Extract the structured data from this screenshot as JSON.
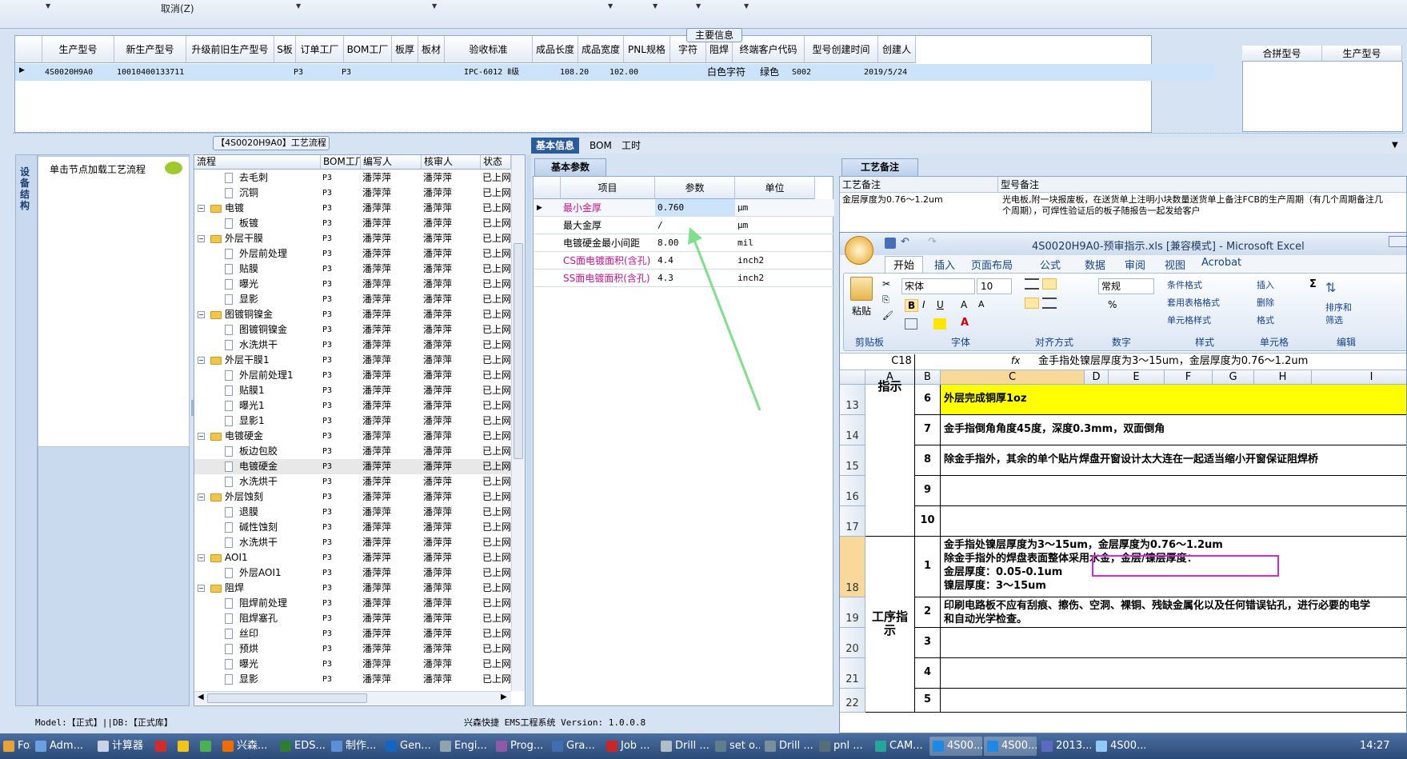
{
  "toolbar": {
    "cancel_label": "取消(Z)"
  },
  "main_info": {
    "title": "主要信息",
    "columns": [
      "生产型号",
      "新生产型号",
      "升级前旧生产型号",
      "S板",
      "订单工厂",
      "BOM工厂",
      "板厚",
      "板材",
      "验收标准",
      "成品长度",
      "成品宽度",
      "PNL规格",
      "字符",
      "阻焊",
      "终端客户代码",
      "型号创建时间",
      "创建人"
    ],
    "row": {
      "prod_model": "4S0020H9A0",
      "new_prod_model": "10010400133711",
      "order_factory": "P3",
      "bom_factory": "P3",
      "accept_std": "IPC-6012 Ⅱ级",
      "length": "108.20",
      "width": "102.00",
      "char": "白色字符",
      "solder": "绿色",
      "customer_code": "S002",
      "created": "2019/5/24"
    },
    "merge_columns": [
      "合拼型号",
      "生产型号"
    ]
  },
  "left_pane": {
    "vertical_tab": "设备结构",
    "click_node_label": "单击节点加载工艺流程"
  },
  "process": {
    "title": "【4S0020H9A0】工艺流程",
    "columns": [
      "流程",
      "BOM工厂",
      "编写人",
      "核审人",
      "状态"
    ],
    "rows": [
      {
        "name": "去毛刺",
        "type": "file",
        "level": 1,
        "factory": "P3",
        "writer": "潘萍萍",
        "reviewer": "潘萍萍",
        "status": "已上网"
      },
      {
        "name": "沉铜",
        "type": "file",
        "level": 1,
        "factory": "P3",
        "writer": "潘萍萍",
        "reviewer": "潘萍萍",
        "status": "已上网"
      },
      {
        "name": "电镀",
        "type": "folder",
        "level": 0,
        "factory": "P3",
        "writer": "潘萍萍",
        "reviewer": "潘萍萍",
        "status": "已上网"
      },
      {
        "name": "板镀",
        "type": "file",
        "level": 1,
        "factory": "P3",
        "writer": "潘萍萍",
        "reviewer": "潘萍萍",
        "status": "已上网"
      },
      {
        "name": "外层干膜",
        "type": "folder",
        "level": 0,
        "factory": "P3",
        "writer": "潘萍萍",
        "reviewer": "潘萍萍",
        "status": "已上网"
      },
      {
        "name": "外层前处理",
        "type": "file",
        "level": 1,
        "factory": "P3",
        "writer": "潘萍萍",
        "reviewer": "潘萍萍",
        "status": "已上网"
      },
      {
        "name": "贴膜",
        "type": "file",
        "level": 1,
        "factory": "P3",
        "writer": "潘萍萍",
        "reviewer": "潘萍萍",
        "status": "已上网"
      },
      {
        "name": "曝光",
        "type": "file",
        "level": 1,
        "factory": "P3",
        "writer": "潘萍萍",
        "reviewer": "潘萍萍",
        "status": "已上网"
      },
      {
        "name": "显影",
        "type": "file",
        "level": 1,
        "factory": "P3",
        "writer": "潘萍萍",
        "reviewer": "潘萍萍",
        "status": "已上网"
      },
      {
        "name": "图镀铜镍金",
        "type": "folder",
        "level": 0,
        "factory": "P3",
        "writer": "潘萍萍",
        "reviewer": "潘萍萍",
        "status": "已上网"
      },
      {
        "name": "图镀铜镍金",
        "type": "file",
        "level": 1,
        "factory": "P3",
        "writer": "潘萍萍",
        "reviewer": "潘萍萍",
        "status": "已上网"
      },
      {
        "name": "水洗烘干",
        "type": "file",
        "level": 1,
        "factory": "P3",
        "writer": "潘萍萍",
        "reviewer": "潘萍萍",
        "status": "已上网"
      },
      {
        "name": "外层干膜1",
        "type": "folder",
        "level": 0,
        "factory": "P3",
        "writer": "潘萍萍",
        "reviewer": "潘萍萍",
        "status": "已上网"
      },
      {
        "name": "外层前处理1",
        "type": "file",
        "level": 1,
        "factory": "P3",
        "writer": "潘萍萍",
        "reviewer": "潘萍萍",
        "status": "已上网"
      },
      {
        "name": "贴膜1",
        "type": "file",
        "level": 1,
        "factory": "P3",
        "writer": "潘萍萍",
        "reviewer": "潘萍萍",
        "status": "已上网"
      },
      {
        "name": "曝光1",
        "type": "file",
        "level": 1,
        "factory": "P3",
        "writer": "潘萍萍",
        "reviewer": "潘萍萍",
        "status": "已上网"
      },
      {
        "name": "显影1",
        "type": "file",
        "level": 1,
        "factory": "P3",
        "writer": "潘萍萍",
        "reviewer": "潘萍萍",
        "status": "已上网"
      },
      {
        "name": "电镀硬金",
        "type": "folder",
        "level": 0,
        "factory": "P3",
        "writer": "潘萍萍",
        "reviewer": "潘萍萍",
        "status": "已上网"
      },
      {
        "name": "板边包胶",
        "type": "file",
        "level": 1,
        "factory": "P3",
        "writer": "潘萍萍",
        "reviewer": "潘萍萍",
        "status": "已上网"
      },
      {
        "name": "电镀硬金",
        "type": "file",
        "level": 1,
        "factory": "P3",
        "writer": "潘萍萍",
        "reviewer": "潘萍萍",
        "status": "已上网",
        "selected": true
      },
      {
        "name": "水洗烘干",
        "type": "file",
        "level": 1,
        "factory": "P3",
        "writer": "潘萍萍",
        "reviewer": "潘萍萍",
        "status": "已上网"
      },
      {
        "name": "外层蚀刻",
        "type": "folder",
        "level": 0,
        "factory": "P3",
        "writer": "潘萍萍",
        "reviewer": "潘萍萍",
        "status": "已上网"
      },
      {
        "name": "退膜",
        "type": "file",
        "level": 1,
        "factory": "P3",
        "writer": "潘萍萍",
        "reviewer": "潘萍萍",
        "status": "已上网"
      },
      {
        "name": "碱性蚀刻",
        "type": "file",
        "level": 1,
        "factory": "P3",
        "writer": "潘萍萍",
        "reviewer": "潘萍萍",
        "status": "已上网"
      },
      {
        "name": "水洗烘干",
        "type": "file",
        "level": 1,
        "factory": "P3",
        "writer": "潘萍萍",
        "reviewer": "潘萍萍",
        "status": "已上网"
      },
      {
        "name": "AOI1",
        "type": "folder",
        "level": 0,
        "factory": "P3",
        "writer": "潘萍萍",
        "reviewer": "潘萍萍",
        "status": "已上网"
      },
      {
        "name": "外层AOI1",
        "type": "file",
        "level": 1,
        "factory": "P3",
        "writer": "潘萍萍",
        "reviewer": "潘萍萍",
        "status": "已上网"
      },
      {
        "name": "阻焊",
        "type": "folder",
        "level": 0,
        "factory": "P3",
        "writer": "潘萍萍",
        "reviewer": "潘萍萍",
        "status": "已上网"
      },
      {
        "name": "阻焊前处理",
        "type": "file",
        "level": 1,
        "factory": "P3",
        "writer": "潘萍萍",
        "reviewer": "潘萍萍",
        "status": "已上网"
      },
      {
        "name": "阻焊塞孔",
        "type": "file",
        "level": 1,
        "factory": "P3",
        "writer": "潘萍萍",
        "reviewer": "潘萍萍",
        "status": "已上网"
      },
      {
        "name": "丝印",
        "type": "file",
        "level": 1,
        "factory": "P3",
        "writer": "潘萍萍",
        "reviewer": "潘萍萍",
        "status": "已上网"
      },
      {
        "name": "预烘",
        "type": "file",
        "level": 1,
        "factory": "P3",
        "writer": "潘萍萍",
        "reviewer": "潘萍萍",
        "status": "已上网"
      },
      {
        "name": "曝光",
        "type": "file",
        "level": 1,
        "factory": "P3",
        "writer": "潘萍萍",
        "reviewer": "潘萍萍",
        "status": "已上网"
      },
      {
        "name": "显影",
        "type": "file",
        "level": 1,
        "factory": "P3",
        "writer": "潘萍萍",
        "reviewer": "潘萍萍",
        "status": "已上网"
      }
    ]
  },
  "right_tabs": [
    "基本信息",
    "BOM",
    "工时"
  ],
  "basic_params": {
    "tab": "基本参数",
    "columns": [
      "项目",
      "参数",
      "单位"
    ],
    "rows": [
      {
        "item": "最小金厚",
        "value": "0.760",
        "unit": "μm",
        "highlight": true
      },
      {
        "item": "最大金厚",
        "value": "/",
        "unit": "μm",
        "highlight": false
      },
      {
        "item": "电镀硬金最小间距",
        "value": "8.00",
        "unit": "mil",
        "highlight": false
      },
      {
        "item": "CS面电镀面积(含孔)",
        "value": "4.4",
        "unit": "inch2",
        "highlight": true
      },
      {
        "item": "SS面电镀面积(含孔)",
        "value": "4.3",
        "unit": "inch2",
        "highlight": true
      }
    ]
  },
  "craft_notes": {
    "tab": "工艺备注",
    "columns": [
      "工艺备注",
      "型号备注"
    ],
    "craft_note": "金层厚度为0.76～1.2um",
    "model_note": "光电板,附一块报废板，在送货单上注明小块数量送货单上备注FCB的生产周期（有几个周期备注几个周期），可焊性验证后的板子随报告一起发给客户"
  },
  "excel": {
    "title": "4S0020H9A0-预审指示.xls  [兼容模式] - Microsoft Excel",
    "ribbon_tabs": [
      "开始",
      "插入",
      "页面布局",
      "公式",
      "数据",
      "审阅",
      "视图",
      "Acrobat"
    ],
    "font_name": "宋体",
    "font_size": "10",
    "number_format": "常规",
    "groups": {
      "clipboard": "剪贴板",
      "font": "字体",
      "align": "对齐方式",
      "number": "数字",
      "style": "样式",
      "cells": "单元格",
      "edit": "编辑"
    },
    "paste_label": "粘贴",
    "style_buttons": [
      "条件格式",
      "套用表格格式",
      "单元格样式"
    ],
    "cell_buttons": [
      "插入",
      "删除",
      "格式"
    ],
    "edit_buttons": [
      "排序和",
      "筛选"
    ],
    "name_box": "C18",
    "formula": "金手指处镍层厚度为3～15um，金层厚度为0.76～1.2um",
    "columns": [
      "A",
      "B",
      "C",
      "D",
      "E",
      "F",
      "G",
      "H",
      "I"
    ],
    "label_indicate": "指示",
    "label_process": "工序指示",
    "rows": [
      {
        "row": "13",
        "num": "6",
        "text": "外层完成铜厚1oz",
        "yellow": true
      },
      {
        "row": "14",
        "num": "7",
        "text": "金手指倒角角度45度，深度0.3mm，双面倒角"
      },
      {
        "row": "15",
        "num": "8",
        "text": "除金手指外，其余的单个贴片焊盘开窗设计太大连在一起适当缩小开窗保证阻焊桥"
      },
      {
        "row": "16",
        "num": "9",
        "text": ""
      },
      {
        "row": "17",
        "num": "10",
        "text": ""
      },
      {
        "row": "18",
        "num": "1",
        "text": "金手指处镍层厚度为3～15um，金层厚度为0.76～1.2um\n除金手指外的焊盘表面整体采用水金，金层/镍层厚度：\n金层厚度：0.05-0.1um\n镍层厚度：3～15um"
      },
      {
        "row": "19",
        "num": "2",
        "text": "印刷电路板不应有刮痕、擦伤、空洞、裸铜、残缺金属化以及任何错误钻孔，进行必要的电学\n和自动光学检查。"
      },
      {
        "row": "20",
        "num": "3",
        "text": ""
      },
      {
        "row": "21",
        "num": "4",
        "text": ""
      },
      {
        "row": "22",
        "num": "5",
        "text": ""
      }
    ]
  },
  "status_bar": {
    "model_db": "Model:【正式】||DB:【正式库】",
    "system": "兴森快捷 EMS工程系统 Version: 1.0.0.8"
  },
  "taskbar": {
    "items": [
      "Fox...",
      "Adm...",
      "计算器",
      "",
      "",
      "",
      "兴森...",
      "EDS...",
      "制作...",
      "Gen...",
      "Engi...",
      "Prog...",
      "Gra...",
      "Job ...",
      "Drill ...",
      "set o...",
      "Drill ...",
      "pnl ...",
      "CAM...",
      "4S00...",
      "4S00...",
      "2013...",
      "4S00..."
    ],
    "clock": "14:27"
  },
  "colors": {
    "accent": "#2c5b9a",
    "selected_row": "#cde3fa",
    "highlight_text": "#c0158e",
    "excel_yellow": "#ffff00",
    "annotation_box": "#d229d6",
    "annotation_arrow": "#7ee08a"
  }
}
